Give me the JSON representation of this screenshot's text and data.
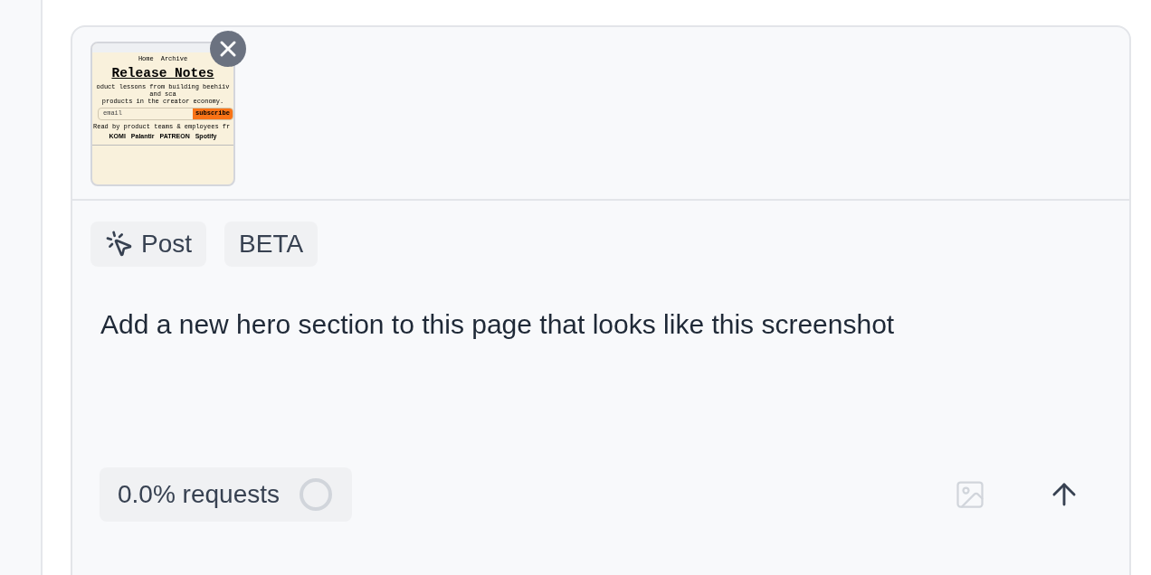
{
  "attachment": {
    "kind": "screenshot",
    "nav": [
      "Home",
      "Archive"
    ],
    "title": "Release Notes",
    "subtitle_lines": [
      "oduct lessons from building beehiiv and sca",
      "products in the creator economy."
    ],
    "email_placeholder": "email",
    "subscribe": "subscribe",
    "social_proof": "Read by product teams & employees fr",
    "logos": [
      "KOMI",
      "Palantir",
      "PATREON",
      "Spotify"
    ]
  },
  "chips": [
    {
      "label": "Post",
      "kind": "mode"
    },
    {
      "label": "BETA",
      "kind": "badge"
    }
  ],
  "prompt": "Add a new hero section to this page that looks like this screenshot",
  "usage": {
    "label": "0.0% requests"
  }
}
